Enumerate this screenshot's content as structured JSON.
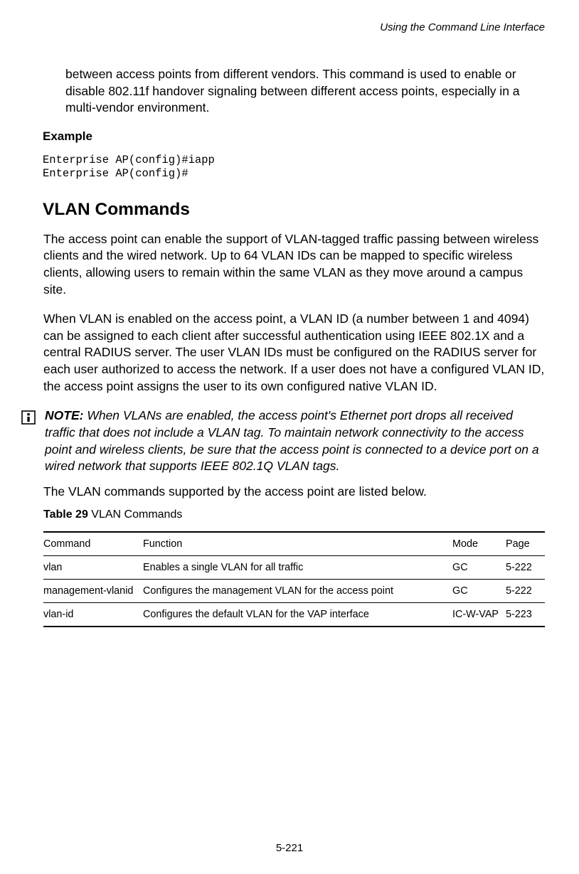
{
  "header": {
    "title": "Using the Command Line Interface"
  },
  "intro_para": "between access points from different vendors. This command is used to enable or disable 802.11f handover signaling between different access points, especially in a multi-vendor environment.",
  "example": {
    "heading": "Example",
    "code": "Enterprise AP(config)#iapp\nEnterprise AP(config)#"
  },
  "section": {
    "heading": "VLAN Commands",
    "para1": "The access point can enable the support of VLAN-tagged traffic passing between wireless clients and the wired network. Up to 64 VLAN IDs can be mapped to specific wireless clients, allowing users to remain within the same VLAN as they move around a campus site.",
    "para2": "When VLAN is enabled on the access point, a VLAN ID (a number between 1 and 4094) can be assigned to each client after successful authentication using IEEE 802.1X and a central RADIUS server. The user VLAN IDs must be configured on the RADIUS server for each user authorized to access the network. If a user does not have a configured VLAN ID, the access point assigns the user to its own configured native VLAN ID."
  },
  "note": {
    "label": "NOTE:",
    "text": " When VLANs are enabled, the access point's Ethernet port drops all received traffic that does not include a VLAN tag. To maintain network connectivity to the access point and wireless clients, be sure that the access point is connected to a device port on a wired network that supports IEEE 802.1Q VLAN tags."
  },
  "after_note": "The VLAN commands supported by the access point are listed below.",
  "table": {
    "caption_label": "Table 29",
    "caption_text": "   VLAN Commands",
    "headers": [
      "Command",
      "Function",
      "Mode",
      "Page"
    ],
    "rows": [
      {
        "command": "vlan",
        "function": "Enables a single VLAN for all traffic",
        "mode": "GC",
        "page": "5-222"
      },
      {
        "command": "management-vlanid",
        "function": "Configures the management VLAN for the access point",
        "mode": "GC",
        "page": "5-222"
      },
      {
        "command": "vlan-id",
        "function": "Configures the default VLAN for the VAP interface",
        "mode": "IC-W-VAP",
        "page": "5-223"
      }
    ]
  },
  "page_number": "5-221"
}
